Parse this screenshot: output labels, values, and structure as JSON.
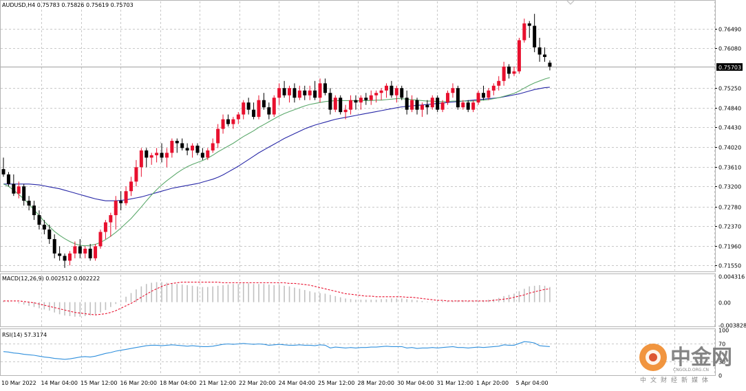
{
  "chart_data": [
    {
      "type": "candlestick",
      "title": "AUDUSD,H4  0.75783 0.75826 0.75619 0.75703",
      "last_price_label": "0.75703",
      "last_price": 0.75703,
      "ylim": [
        0.7144,
        0.7706
      ],
      "y_ticks": [
        "0.76490",
        "0.76080",
        "0.75250",
        "0.74840",
        "0.74430",
        "0.74020",
        "0.73610",
        "0.73200",
        "0.72780",
        "0.72370",
        "0.71960",
        "0.71550"
      ],
      "x_ticks": [
        "10 Mar 2022",
        "14 Mar 04:00",
        "15 Mar 12:00",
        "16 Mar 20:00",
        "18 Mar 04:00",
        "21 Mar 12:00",
        "22 Mar 20:00",
        "24 Mar 04:00",
        "25 Mar 12:00",
        "28 Mar 20:00",
        "30 Mar 04:00",
        "31 Mar 12:00",
        "1 Apr 20:00",
        "5 Apr 04:00"
      ],
      "colors": {
        "bull": "#e8102e",
        "bear": "#000000",
        "ma_fast": "#5aa86a",
        "ma_slow": "#2626a6",
        "grid": "#c8c8c8"
      },
      "candles": [
        [
          0.7356,
          0.738,
          0.734,
          0.7345
        ],
        [
          0.7345,
          0.735,
          0.732,
          0.7325
        ],
        [
          0.7325,
          0.7345,
          0.73,
          0.7305
        ],
        [
          0.7305,
          0.733,
          0.7295,
          0.732
        ],
        [
          0.732,
          0.7325,
          0.728,
          0.729
        ],
        [
          0.729,
          0.73,
          0.727,
          0.728
        ],
        [
          0.728,
          0.729,
          0.725,
          0.726
        ],
        [
          0.726,
          0.727,
          0.723,
          0.724
        ],
        [
          0.724,
          0.725,
          0.722,
          0.723
        ],
        [
          0.723,
          0.724,
          0.72,
          0.721
        ],
        [
          0.721,
          0.722,
          0.717,
          0.718
        ],
        [
          0.718,
          0.7195,
          0.7165,
          0.7175
        ],
        [
          0.7175,
          0.718,
          0.715,
          0.7165
        ],
        [
          0.7165,
          0.7185,
          0.7155,
          0.718
        ],
        [
          0.718,
          0.7205,
          0.717,
          0.7195
        ],
        [
          0.7195,
          0.721,
          0.717,
          0.718
        ],
        [
          0.718,
          0.7195,
          0.717,
          0.719
        ],
        [
          0.719,
          0.72,
          0.7165,
          0.717
        ],
        [
          0.717,
          0.72,
          0.7165,
          0.7195
        ],
        [
          0.7195,
          0.723,
          0.719,
          0.7225
        ],
        [
          0.7225,
          0.725,
          0.721,
          0.7245
        ],
        [
          0.7245,
          0.7265,
          0.7215,
          0.726
        ],
        [
          0.726,
          0.73,
          0.723,
          0.729
        ],
        [
          0.729,
          0.731,
          0.727,
          0.7285
        ],
        [
          0.7285,
          0.732,
          0.728,
          0.731
        ],
        [
          0.731,
          0.734,
          0.73,
          0.733
        ],
        [
          0.733,
          0.7375,
          0.732,
          0.736
        ],
        [
          0.736,
          0.74,
          0.734,
          0.7395
        ],
        [
          0.7395,
          0.74,
          0.736,
          0.738
        ],
        [
          0.738,
          0.739,
          0.7365,
          0.7385
        ],
        [
          0.7385,
          0.74,
          0.737,
          0.739
        ],
        [
          0.739,
          0.741,
          0.737,
          0.738
        ],
        [
          0.738,
          0.74,
          0.736,
          0.739
        ],
        [
          0.739,
          0.742,
          0.738,
          0.7415
        ],
        [
          0.7415,
          0.742,
          0.739,
          0.741
        ],
        [
          0.741,
          0.742,
          0.7395,
          0.74
        ],
        [
          0.74,
          0.741,
          0.7385,
          0.7395
        ],
        [
          0.7395,
          0.741,
          0.738,
          0.7405
        ],
        [
          0.7405,
          0.741,
          0.7385,
          0.739
        ],
        [
          0.739,
          0.74,
          0.7375,
          0.738
        ],
        [
          0.738,
          0.74,
          0.7375,
          0.7395
        ],
        [
          0.7395,
          0.742,
          0.739,
          0.741
        ],
        [
          0.741,
          0.745,
          0.74,
          0.744
        ],
        [
          0.744,
          0.747,
          0.743,
          0.746
        ],
        [
          0.746,
          0.747,
          0.7445,
          0.745
        ],
        [
          0.745,
          0.7465,
          0.744,
          0.746
        ],
        [
          0.746,
          0.7475,
          0.745,
          0.747
        ],
        [
          0.747,
          0.75,
          0.746,
          0.7495
        ],
        [
          0.7495,
          0.7505,
          0.747,
          0.748
        ],
        [
          0.748,
          0.7495,
          0.746,
          0.7465
        ],
        [
          0.7465,
          0.751,
          0.746,
          0.75
        ],
        [
          0.75,
          0.7515,
          0.748,
          0.7485
        ],
        [
          0.7485,
          0.7495,
          0.746,
          0.747
        ],
        [
          0.747,
          0.751,
          0.7465,
          0.7505
        ],
        [
          0.7505,
          0.7535,
          0.749,
          0.7525
        ],
        [
          0.7525,
          0.754,
          0.7505,
          0.751
        ],
        [
          0.751,
          0.753,
          0.7495,
          0.7525
        ],
        [
          0.7525,
          0.7535,
          0.7495,
          0.7505
        ],
        [
          0.7505,
          0.753,
          0.75,
          0.752
        ],
        [
          0.752,
          0.753,
          0.75,
          0.751
        ],
        [
          0.751,
          0.753,
          0.75,
          0.752
        ],
        [
          0.752,
          0.754,
          0.75,
          0.7505
        ],
        [
          0.7505,
          0.7545,
          0.7495,
          0.7535
        ],
        [
          0.7535,
          0.7545,
          0.751,
          0.7515
        ],
        [
          0.7515,
          0.7525,
          0.747,
          0.748
        ],
        [
          0.748,
          0.751,
          0.7475,
          0.7505
        ],
        [
          0.7505,
          0.751,
          0.747,
          0.7475
        ],
        [
          0.7475,
          0.749,
          0.746,
          0.748
        ],
        [
          0.748,
          0.751,
          0.747,
          0.75
        ],
        [
          0.75,
          0.751,
          0.748,
          0.7495
        ],
        [
          0.7495,
          0.751,
          0.748,
          0.7505
        ],
        [
          0.7505,
          0.7515,
          0.749,
          0.75
        ],
        [
          0.75,
          0.752,
          0.749,
          0.751
        ],
        [
          0.751,
          0.752,
          0.7495,
          0.7515
        ],
        [
          0.7515,
          0.7525,
          0.75,
          0.752
        ],
        [
          0.752,
          0.7535,
          0.7505,
          0.753
        ],
        [
          0.753,
          0.754,
          0.7505,
          0.751
        ],
        [
          0.751,
          0.753,
          0.7495,
          0.7525
        ],
        [
          0.7525,
          0.753,
          0.75,
          0.7505
        ],
        [
          0.7505,
          0.752,
          0.747,
          0.748
        ],
        [
          0.748,
          0.751,
          0.7475,
          0.75
        ],
        [
          0.75,
          0.7505,
          0.747,
          0.748
        ],
        [
          0.748,
          0.7495,
          0.7465,
          0.749
        ],
        [
          0.749,
          0.75,
          0.747,
          0.7485
        ],
        [
          0.7485,
          0.751,
          0.748,
          0.7505
        ],
        [
          0.7505,
          0.751,
          0.7475,
          0.748
        ],
        [
          0.748,
          0.75,
          0.7475,
          0.7495
        ],
        [
          0.7495,
          0.752,
          0.749,
          0.7515
        ],
        [
          0.7515,
          0.7535,
          0.7505,
          0.7525
        ],
        [
          0.7525,
          0.753,
          0.748,
          0.7485
        ],
        [
          0.7485,
          0.75,
          0.748,
          0.7495
        ],
        [
          0.7495,
          0.75,
          0.7475,
          0.748
        ],
        [
          0.748,
          0.75,
          0.7475,
          0.7495
        ],
        [
          0.7495,
          0.752,
          0.749,
          0.7515
        ],
        [
          0.7515,
          0.753,
          0.75,
          0.7505
        ],
        [
          0.7505,
          0.7525,
          0.75,
          0.752
        ],
        [
          0.752,
          0.7535,
          0.751,
          0.753
        ],
        [
          0.753,
          0.755,
          0.752,
          0.754
        ],
        [
          0.754,
          0.758,
          0.753,
          0.757
        ],
        [
          0.757,
          0.7575,
          0.7545,
          0.7555
        ],
        [
          0.7555,
          0.757,
          0.755,
          0.756
        ],
        [
          0.756,
          0.763,
          0.7555,
          0.7625
        ],
        [
          0.7625,
          0.767,
          0.762,
          0.766
        ],
        [
          0.766,
          0.7665,
          0.763,
          0.7655
        ],
        [
          0.7655,
          0.768,
          0.76,
          0.761
        ],
        [
          0.761,
          0.763,
          0.758,
          0.7595
        ],
        [
          0.7595,
          0.761,
          0.758,
          0.759
        ],
        [
          0.7578,
          0.7583,
          0.7562,
          0.757
        ]
      ],
      "ma_fast": [
        0.7325,
        0.732,
        0.7312,
        0.7303,
        0.7294,
        0.7283,
        0.7271,
        0.7259,
        0.7247,
        0.7236,
        0.7226,
        0.7218,
        0.7211,
        0.7205,
        0.72,
        0.7197,
        0.7196,
        0.7197,
        0.7199,
        0.7203,
        0.7209,
        0.7216,
        0.7224,
        0.7233,
        0.7243,
        0.7253,
        0.7265,
        0.7277,
        0.729,
        0.7302,
        0.7313,
        0.7323,
        0.7332,
        0.734,
        0.7348,
        0.7355,
        0.7361,
        0.7366,
        0.737,
        0.7374,
        0.7379,
        0.7385,
        0.7392,
        0.7398,
        0.7404,
        0.741,
        0.7417,
        0.7424,
        0.743,
        0.7436,
        0.7443,
        0.7449,
        0.7455,
        0.7461,
        0.7467,
        0.7472,
        0.7476,
        0.748,
        0.7484,
        0.7488,
        0.7491,
        0.7493,
        0.7495,
        0.7497,
        0.7498,
        0.7499,
        0.7499,
        0.7499,
        0.7499,
        0.7499,
        0.7499,
        0.7499,
        0.7499,
        0.75,
        0.75,
        0.7501,
        0.7502,
        0.7503,
        0.7503,
        0.7502,
        0.7501,
        0.75,
        0.7499,
        0.7498,
        0.7498,
        0.7497,
        0.7497,
        0.7497,
        0.7498,
        0.7498,
        0.7498,
        0.7498,
        0.7498,
        0.7499,
        0.75,
        0.7501,
        0.7503,
        0.7505,
        0.7508,
        0.7511,
        0.7514,
        0.7519,
        0.7525,
        0.7531,
        0.7536,
        0.754,
        0.7544,
        0.7547
      ],
      "ma_slow": [
        0.7325,
        0.7325,
        0.7325,
        0.7325,
        0.7325,
        0.7325,
        0.7324,
        0.7323,
        0.7321,
        0.7319,
        0.7317,
        0.7315,
        0.7312,
        0.7309,
        0.7306,
        0.7303,
        0.73,
        0.7297,
        0.7294,
        0.7292,
        0.729,
        0.729,
        0.729,
        0.7291,
        0.7292,
        0.7294,
        0.7296,
        0.7298,
        0.7301,
        0.7304,
        0.7307,
        0.731,
        0.7313,
        0.7316,
        0.7318,
        0.732,
        0.7322,
        0.7324,
        0.7326,
        0.7329,
        0.7332,
        0.7335,
        0.7339,
        0.7344,
        0.735,
        0.7356,
        0.7362,
        0.7369,
        0.7376,
        0.7383,
        0.739,
        0.7396,
        0.7402,
        0.7408,
        0.7414,
        0.742,
        0.7425,
        0.743,
        0.7435,
        0.744,
        0.7444,
        0.7448,
        0.7451,
        0.7454,
        0.7457,
        0.746,
        0.7462,
        0.7464,
        0.7466,
        0.7468,
        0.747,
        0.7472,
        0.7474,
        0.7476,
        0.7478,
        0.748,
        0.7482,
        0.7484,
        0.7486,
        0.7487,
        0.7488,
        0.7489,
        0.749,
        0.7491,
        0.7492,
        0.7493,
        0.7494,
        0.7495,
        0.7496,
        0.7497,
        0.7498,
        0.7499,
        0.75,
        0.7501,
        0.7502,
        0.7503,
        0.7504,
        0.7505,
        0.7507,
        0.7509,
        0.7511,
        0.7513,
        0.7516,
        0.7519,
        0.7522,
        0.7524,
        0.7526,
        0.7527
      ]
    },
    {
      "type": "macd",
      "title": "MACD(12,26,9) 0.002512 0.002222",
      "ylim": [
        -0.004,
        0.0045
      ],
      "y_ticks": [
        "0.004316",
        "0.00",
        "-0.003828"
      ],
      "colors": {
        "hist": "#c0c0c0",
        "signal": "#e8102e"
      },
      "hist": [
        0.0002,
        0.0001,
        0.0,
        -0.0002,
        -0.0004,
        -0.0006,
        -0.0008,
        -0.001,
        -0.0012,
        -0.0014,
        -0.0017,
        -0.002,
        -0.0022,
        -0.0023,
        -0.0024,
        -0.0024,
        -0.0023,
        -0.0022,
        -0.002,
        -0.0017,
        -0.0013,
        -0.0008,
        -0.0003,
        0.0003,
        0.0009,
        0.0015,
        0.0021,
        0.0026,
        0.003,
        0.0032,
        0.0033,
        0.0033,
        0.0032,
        0.0031,
        0.003,
        0.0029,
        0.0028,
        0.0027,
        0.0026,
        0.0025,
        0.0025,
        0.0026,
        0.0027,
        0.0028,
        0.0029,
        0.003,
        0.003,
        0.0031,
        0.0031,
        0.003,
        0.003,
        0.003,
        0.0029,
        0.0028,
        0.0028,
        0.0027,
        0.0026,
        0.0024,
        0.0022,
        0.002,
        0.0018,
        0.0016,
        0.0015,
        0.0014,
        0.0012,
        0.001,
        0.0008,
        0.0006,
        0.0005,
        0.0004,
        0.0004,
        0.0004,
        0.0004,
        0.0004,
        0.0005,
        0.0005,
        0.0006,
        0.0006,
        0.0006,
        0.0005,
        0.0004,
        0.0003,
        0.0002,
        0.0001,
        0.0001,
        0.0001,
        0.0002,
        0.0002,
        0.0002,
        0.0003,
        0.0003,
        0.0002,
        0.0002,
        0.0002,
        0.0003,
        0.0004,
        0.0005,
        0.0007,
        0.001,
        0.0012,
        0.0014,
        0.0018,
        0.0022,
        0.0026,
        0.0027,
        0.0028,
        0.0027,
        0.0025
      ],
      "signal": [
        0.0002,
        0.0002,
        0.0002,
        0.0002,
        0.0001,
        0.0,
        -0.0001,
        -0.0003,
        -0.0005,
        -0.0007,
        -0.0009,
        -0.0011,
        -0.0013,
        -0.0015,
        -0.0017,
        -0.0018,
        -0.0019,
        -0.002,
        -0.0021,
        -0.002,
        -0.0019,
        -0.0017,
        -0.0014,
        -0.001,
        -0.0006,
        -0.0002,
        0.0003,
        0.0008,
        0.0013,
        0.0018,
        0.0022,
        0.0026,
        0.0029,
        0.0031,
        0.0032,
        0.0033,
        0.0033,
        0.0033,
        0.0033,
        0.0033,
        0.0033,
        0.0033,
        0.0033,
        0.0032,
        0.0032,
        0.0032,
        0.0032,
        0.0032,
        0.0032,
        0.0032,
        0.0032,
        0.0032,
        0.0032,
        0.0032,
        0.0032,
        0.0032,
        0.0031,
        0.0031,
        0.003,
        0.0029,
        0.0028,
        0.0026,
        0.0024,
        0.0022,
        0.002,
        0.0018,
        0.0016,
        0.0014,
        0.0013,
        0.0012,
        0.0011,
        0.001,
        0.001,
        0.0009,
        0.0009,
        0.0009,
        0.0009,
        0.0009,
        0.0009,
        0.0008,
        0.0008,
        0.0007,
        0.0006,
        0.0005,
        0.0004,
        0.0003,
        0.0003,
        0.0002,
        0.0002,
        0.0002,
        0.0002,
        0.0002,
        0.0002,
        0.0002,
        0.0002,
        0.0002,
        0.0003,
        0.0004,
        0.0005,
        0.0006,
        0.0008,
        0.001,
        0.0012,
        0.0015,
        0.0017,
        0.0019,
        0.0021,
        0.0022
      ]
    },
    {
      "type": "line",
      "title": "RSI(14) 57.3174",
      "ylim": [
        0,
        100
      ],
      "y_ticks": [
        "100",
        "70",
        "30",
        "0"
      ],
      "colors": {
        "line": "#2f8fdc",
        "level": "#c8c8c8"
      },
      "values": [
        52,
        51,
        49,
        48,
        46,
        45,
        44,
        42,
        40,
        39,
        37,
        36,
        35,
        36,
        38,
        40,
        41,
        40,
        42,
        45,
        48,
        50,
        53,
        55,
        57,
        59,
        61,
        63,
        65,
        66,
        66,
        65,
        66,
        67,
        66,
        65,
        64,
        65,
        64,
        63,
        63,
        64,
        66,
        68,
        69,
        68,
        69,
        70,
        69,
        68,
        69,
        68,
        66,
        67,
        68,
        67,
        66,
        66,
        67,
        66,
        66,
        65,
        67,
        66,
        60,
        62,
        61,
        60,
        61,
        60,
        61,
        61,
        62,
        62,
        63,
        64,
        63,
        63,
        63,
        60,
        61,
        59,
        60,
        60,
        61,
        60,
        61,
        62,
        63,
        61,
        61,
        60,
        61,
        62,
        61,
        62,
        63,
        64,
        67,
        66,
        66,
        70,
        74,
        73,
        71,
        65,
        64,
        63
      ]
    }
  ],
  "watermark": {
    "brand": "中金网",
    "url": "CNGOLD.ORG.CN",
    "subtitle": "中文财经新媒体"
  }
}
